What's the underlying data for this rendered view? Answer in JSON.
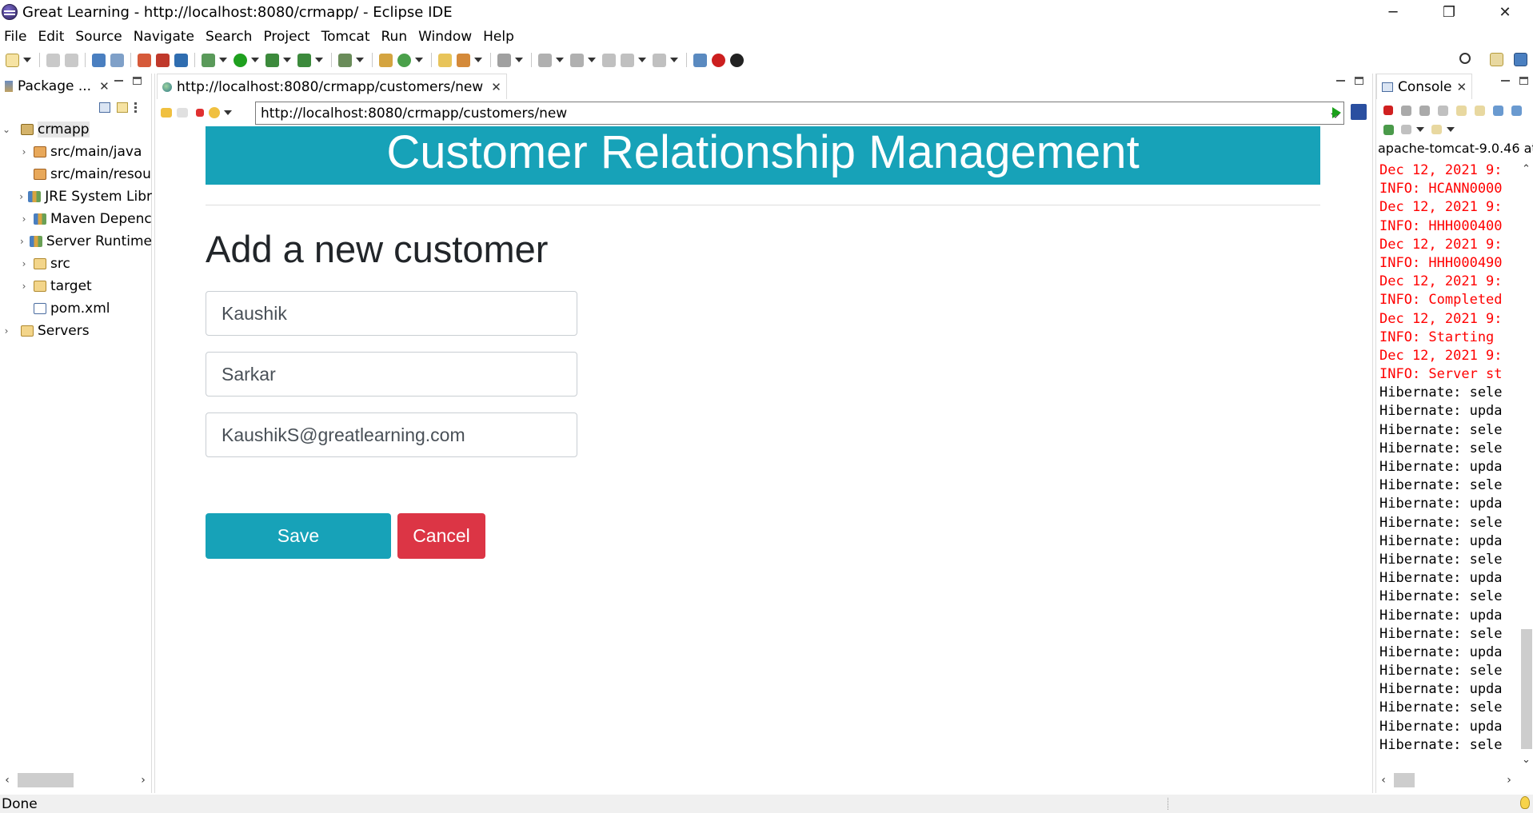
{
  "window": {
    "title": "Great Learning - http://localhost:8080/crmapp/ - Eclipse IDE",
    "controls": {
      "minimize": "─",
      "restore": "❐",
      "close": "✕"
    }
  },
  "menu": [
    "File",
    "Edit",
    "Source",
    "Navigate",
    "Search",
    "Project",
    "Tomcat",
    "Run",
    "Window",
    "Help"
  ],
  "package_explorer": {
    "tab_label": "Package ...",
    "tree": [
      {
        "label": "crmapp",
        "expanded": true,
        "icon": "project-icon"
      },
      {
        "label": "src/main/java",
        "icon": "package-root-icon"
      },
      {
        "label": "src/main/resou",
        "icon": "package-root-icon"
      },
      {
        "label": "JRE System Libr",
        "icon": "library-icon"
      },
      {
        "label": "Maven Depenc",
        "icon": "library-icon"
      },
      {
        "label": "Server Runtime",
        "icon": "library-icon"
      },
      {
        "label": "src",
        "icon": "folder-icon"
      },
      {
        "label": "target",
        "icon": "folder-icon"
      },
      {
        "label": "pom.xml",
        "icon": "xml-file-icon"
      },
      {
        "label": "Servers",
        "icon": "folder-icon"
      }
    ]
  },
  "editor": {
    "tab_label": "http://localhost:8080/crmapp/customers/new",
    "url": "http://localhost:8080/crmapp/customers/new"
  },
  "page": {
    "banner": "Customer Relationship Management",
    "heading": "Add a new customer",
    "first_name": "Kaushik",
    "last_name": "Sarkar",
    "email": "KaushikS@greatlearning.com",
    "save_label": "Save",
    "cancel_label": "Cancel",
    "accent_color": "#17a2b8",
    "danger_color": "#dc3545"
  },
  "console": {
    "tab_label": "Console",
    "server": "apache-tomcat-9.0.46 at",
    "lines": [
      {
        "text": "Dec 12, 2021 9:",
        "type": "err"
      },
      {
        "text": "INFO: HCANN0000",
        "type": "err"
      },
      {
        "text": "Dec 12, 2021 9:",
        "type": "err"
      },
      {
        "text": "INFO: HHH000400",
        "type": "err"
      },
      {
        "text": "Dec 12, 2021 9:",
        "type": "err"
      },
      {
        "text": "INFO: HHH000490",
        "type": "err"
      },
      {
        "text": "Dec 12, 2021 9:",
        "type": "err"
      },
      {
        "text": "INFO: Completed",
        "type": "err"
      },
      {
        "text": "Dec 12, 2021 9:",
        "type": "err"
      },
      {
        "text": "INFO: Starting",
        "type": "err"
      },
      {
        "text": "Dec 12, 2021 9:",
        "type": "err"
      },
      {
        "text": "INFO: Server st",
        "type": "err"
      },
      {
        "text": "Hibernate: sele",
        "type": "out"
      },
      {
        "text": "Hibernate: upda",
        "type": "out"
      },
      {
        "text": "Hibernate: sele",
        "type": "out"
      },
      {
        "text": "Hibernate: sele",
        "type": "out"
      },
      {
        "text": "Hibernate: upda",
        "type": "out"
      },
      {
        "text": "Hibernate: sele",
        "type": "out"
      },
      {
        "text": "Hibernate: upda",
        "type": "out"
      },
      {
        "text": "Hibernate: sele",
        "type": "out"
      },
      {
        "text": "Hibernate: upda",
        "type": "out"
      },
      {
        "text": "Hibernate: sele",
        "type": "out"
      },
      {
        "text": "Hibernate: upda",
        "type": "out"
      },
      {
        "text": "Hibernate: sele",
        "type": "out"
      },
      {
        "text": "Hibernate: upda",
        "type": "out"
      },
      {
        "text": "Hibernate: sele",
        "type": "out"
      },
      {
        "text": "Hibernate: upda",
        "type": "out"
      },
      {
        "text": "Hibernate: sele",
        "type": "out"
      },
      {
        "text": "Hibernate: upda",
        "type": "out"
      },
      {
        "text": "Hibernate: sele",
        "type": "out"
      },
      {
        "text": "Hibernate: upda",
        "type": "out"
      },
      {
        "text": "Hibernate: sele",
        "type": "out"
      }
    ]
  },
  "status": {
    "text": "Done"
  }
}
